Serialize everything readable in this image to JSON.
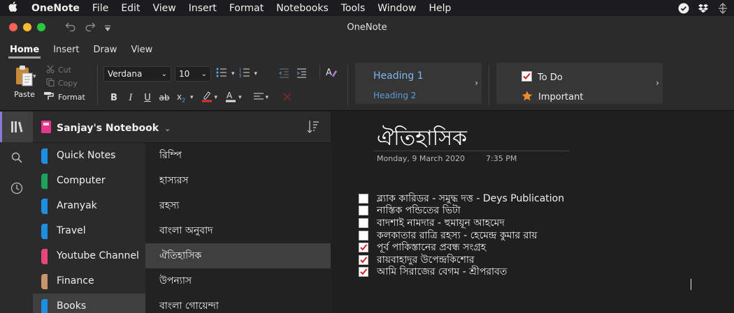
{
  "menubar": {
    "app_name": "OneNote",
    "items": [
      "File",
      "Edit",
      "View",
      "Insert",
      "Format",
      "Notebooks",
      "Tools",
      "Window",
      "Help"
    ]
  },
  "window": {
    "title": "OneNote"
  },
  "ribbon": {
    "tabs": [
      "Home",
      "Insert",
      "Draw",
      "View"
    ],
    "active_tab": "Home",
    "clipboard": {
      "paste": "Paste",
      "cut": "Cut",
      "copy": "Copy",
      "format": "Format"
    },
    "font_name": "Verdana",
    "font_size": "10",
    "styles": {
      "heading1": "Heading 1",
      "heading2": "Heading 2"
    },
    "tags": {
      "todo": "To Do",
      "important": "Important"
    },
    "colors": {
      "highlight": "#f0c400",
      "font_color": "#e03030"
    }
  },
  "notebook": {
    "name": "Sanjay's Notebook",
    "sections": [
      {
        "name": "Quick Notes",
        "color": "#1e8fe0"
      },
      {
        "name": "Computer",
        "color": "#1ea35a"
      },
      {
        "name": "Aranyak",
        "color": "#1e8fe0"
      },
      {
        "name": "Travel",
        "color": "#1e8fe0"
      },
      {
        "name": "Youtube Channel",
        "color": "#e8477a"
      },
      {
        "name": "Finance",
        "color": "#c8946a"
      },
      {
        "name": "Books",
        "color": "#1e8fe0"
      }
    ],
    "active_section": "Books",
    "pages": [
      "রিম্পি",
      "হাস্যরস",
      "রহস্য",
      "বাংলা অনুবাদ",
      "ঐতিহাসিক",
      "উপন্যাস",
      "বাংলা গোয়েন্দা"
    ],
    "active_page": "ঐতিহাসিক"
  },
  "page": {
    "title": "ঐতিহাসিক",
    "date": "Monday, 9 March 2020",
    "time": "7:35 PM",
    "todos": [
      {
        "text": "ব্ল্যাক কারিডর - সমুদ্ধ দত্ত - Deys Publication",
        "checked": false
      },
      {
        "text": "নাস্তিক পন্ডিতের ভিটা",
        "checked": false
      },
      {
        "text": "বাদশাই নামদার - হুমায়ূন আহমেদ",
        "checked": false
      },
      {
        "text": "কলকাতার রাত্রি রহস্য - হেমেন্দ্র কুমার রায়",
        "checked": false
      },
      {
        "text": "পূর্ব পাকিস্তানের প্রবন্ধ সংগ্রহ",
        "checked": true
      },
      {
        "text": "রায়বাহাদুর উপেন্দ্রকিশোর",
        "checked": true
      },
      {
        "text": "আমি সিরাজের বেগম - শ্রীপরাবত",
        "checked": true
      }
    ]
  }
}
